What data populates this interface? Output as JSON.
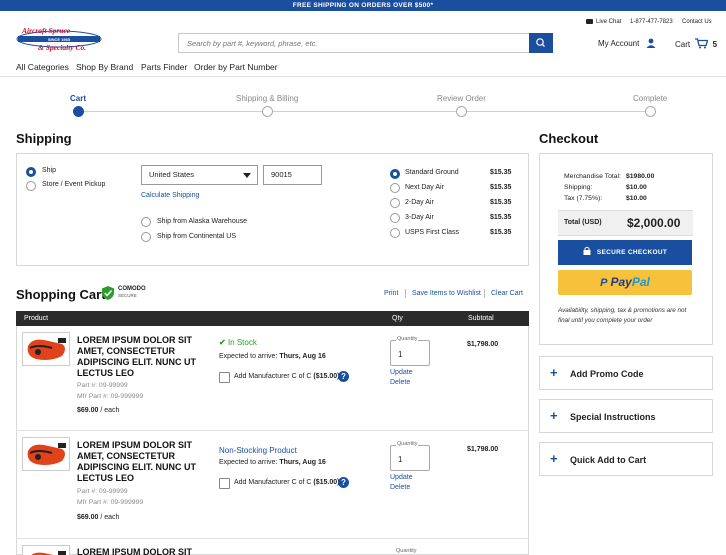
{
  "promo_bar": "FREE SHIPPING ON ORDERS OVER $500*",
  "logo": {
    "line1": "Aircraft Spruce",
    "line2": "& Specialty Co.",
    "since": "SINCE 1965"
  },
  "search": {
    "placeholder": "Search by part #, keyword, phrase, etc."
  },
  "utility": {
    "live_chat": "Live Chat",
    "phone": "1-877-477-7823",
    "contact": "Contact Us"
  },
  "account": {
    "my_account": "My Account",
    "cart": "Cart",
    "cart_count": "5"
  },
  "nav": [
    "All Categories",
    "Shop By Brand",
    "Parts Finder",
    "Order by Part Number"
  ],
  "steps": [
    {
      "label": "Cart",
      "active": true
    },
    {
      "label": "Shipping & Billing",
      "active": false
    },
    {
      "label": "Review Order",
      "active": false
    },
    {
      "label": "Complete",
      "active": false
    }
  ],
  "shipping": {
    "title": "Shipping",
    "options": [
      {
        "label": "Ship",
        "selected": true
      },
      {
        "label": "Store / Event Pickup",
        "selected": false
      }
    ],
    "country": "United States",
    "zip": "90015",
    "calc_link": "Calculate Shipping",
    "warehouses": [
      "Ship from Alaska Warehouse",
      "Ship from Continental US"
    ],
    "methods": [
      {
        "label": "Standard Ground",
        "price": "$15.35",
        "selected": true
      },
      {
        "label": "Next Day Air",
        "price": "$15.35",
        "selected": false
      },
      {
        "label": "2-Day Air",
        "price": "$15.35",
        "selected": false
      },
      {
        "label": "3-Day Air",
        "price": "$15.35",
        "selected": false
      },
      {
        "label": "USPS First Class",
        "price": "$15.35",
        "selected": false
      }
    ]
  },
  "cart": {
    "title": "Shopping Cart",
    "comodo": "COMODO",
    "comodo_sub": "SECURE",
    "actions": [
      "Print",
      "Save Items to Wishlist",
      "Clear Cart"
    ],
    "columns": {
      "product": "Product",
      "qty": "Qty",
      "subtotal": "Subtotal"
    },
    "items": [
      {
        "title_lines": [
          "LOREM IPSUM DOLOR SIT",
          "AMET, CONSECTETUR",
          "ADIPISCING ELIT. NUNC UT",
          "LECTUS LEO"
        ],
        "part": "Part #: 09-99999",
        "mfr_part": "Mfr Part #: 09-999999",
        "price": "$69.00",
        "per": "/ each",
        "status": "In Stock",
        "status_kind": "instock",
        "arrival_label": "Expected to arrive:",
        "arrival_date": "Thurs, Aug 16",
        "addon": "Add Manufacturer C of C",
        "addon_price": "($15.00)",
        "qty_label": "Quantity",
        "qty": "1",
        "update": "Update",
        "delete": "Delete",
        "subtotal": "$1,798.00"
      },
      {
        "title_lines": [
          "LOREM IPSUM DOLOR SIT",
          "AMET, CONSECTETUR",
          "ADIPISCING ELIT. NUNC UT",
          "LECTUS LEO"
        ],
        "part": "Part #: 09-99999",
        "mfr_part": "Mfr Part #: 09-999999",
        "price": "$69.00",
        "per": "/ each",
        "status": "Non-Stocking Product",
        "status_kind": "nonstock",
        "arrival_label": "Expected to arrive:",
        "arrival_date": "Thurs, Aug 16",
        "addon": "Add Manufacturer C of C",
        "addon_price": "($15.00)",
        "qty_label": "Quantity",
        "qty": "1",
        "update": "Update",
        "delete": "Delete",
        "subtotal": "$1,798.00"
      }
    ],
    "partial_item_title": "LOREM IPSUM DOLOR SIT",
    "partial_qty_label": "Quantity"
  },
  "checkout": {
    "title": "Checkout",
    "rows": [
      {
        "label": "Merchandise Total:",
        "value": "$1980.00"
      },
      {
        "label": "Shipping:",
        "value": "$10.00"
      },
      {
        "label": "Tax (7.75%):",
        "value": "$10.00"
      }
    ],
    "total_label": "Total (USD)",
    "total_value": "$2,000.00",
    "secure_btn": "SECURE CHECKOUT",
    "paypal_pay": "Pay",
    "paypal_pal": "Pal",
    "note": "Availability, shipping, tax & promotions are not final until you complete your order",
    "accordions": [
      "Add Promo Code",
      "Special Instructions",
      "Quick Add to Cart"
    ]
  },
  "colors": {
    "brand_blue": "#1a4fa0",
    "paypal_yellow": "#f7c23b",
    "instock_green": "#2a9d2a",
    "header_dark": "#2b2b2b"
  }
}
